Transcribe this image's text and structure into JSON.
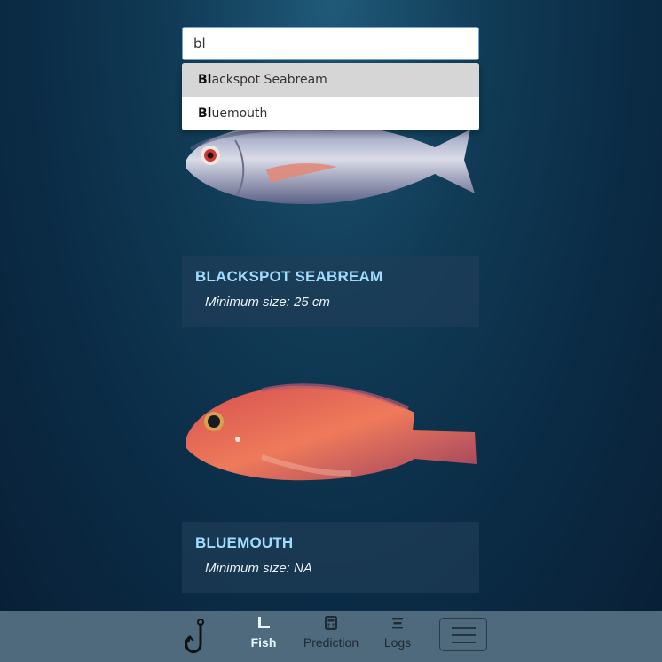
{
  "search": {
    "value": "bl",
    "suggestions": [
      {
        "match": "Bl",
        "rest": "ackspot Seabream"
      },
      {
        "match": "Bl",
        "rest": "uemouth"
      }
    ]
  },
  "fish": [
    {
      "name": "BLACKSPOT SEABREAM",
      "min_size": "Minimum size: 25 cm"
    },
    {
      "name": "BLUEMOUTH",
      "min_size": "Minimum size: NA"
    }
  ],
  "nav": {
    "items": [
      {
        "label": "Fish",
        "icon": "ruler-icon",
        "active": true
      },
      {
        "label": "Prediction",
        "icon": "calculator-icon",
        "active": false
      },
      {
        "label": "Logs",
        "icon": "list-icon",
        "active": false
      }
    ]
  },
  "colors": {
    "card_title": "#9fdcff",
    "navbar_bg": "#4f6a7d",
    "active_suggestion_bg": "#d6d6d6"
  }
}
